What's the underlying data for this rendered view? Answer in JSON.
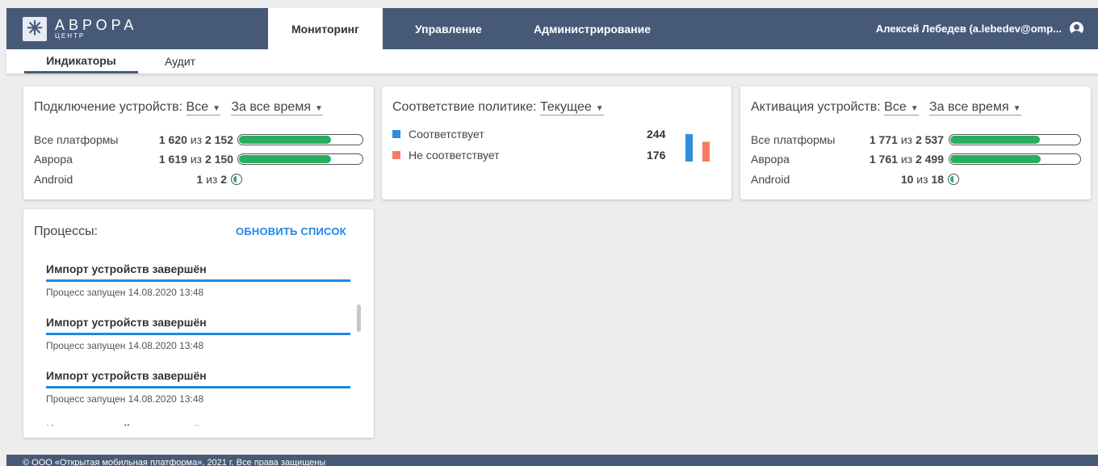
{
  "brand": {
    "name": "АВРОРА",
    "sub": "ЦЕНТР"
  },
  "nav": {
    "tabs": [
      {
        "label": "Мониторинг",
        "active": true
      },
      {
        "label": "Управление",
        "active": false
      },
      {
        "label": "Администрирование",
        "active": false
      }
    ],
    "user": "Алексей Лебедев (a.lebedev@omp..."
  },
  "subnav": {
    "tabs": [
      {
        "label": "Индикаторы",
        "active": true
      },
      {
        "label": "Аудит",
        "active": false
      }
    ]
  },
  "connection": {
    "title": "Подключение устройств:",
    "filter1": "Все",
    "filter2": "За все время",
    "rows": [
      {
        "label": "Все платформы",
        "value": "1 620",
        "sep": "из",
        "total": "2 152",
        "fraction": 0.753
      },
      {
        "label": "Аврора",
        "value": "1 619",
        "sep": "из",
        "total": "2 150",
        "fraction": 0.753
      },
      {
        "label": "Android",
        "value": "1",
        "sep": "из",
        "total": "2",
        "fraction": 0.5
      }
    ]
  },
  "compliance": {
    "title": "Соответствие политике:",
    "filter": "Текущее",
    "items": [
      {
        "label": "Соответствует",
        "value": "244",
        "color": "#2d8fdd"
      },
      {
        "label": "Не соответствует",
        "value": "176",
        "color": "#f47c63"
      }
    ]
  },
  "activation": {
    "title": "Активация устройств:",
    "filter1": "Все",
    "filter2": "За все время",
    "rows": [
      {
        "label": "Все платформы",
        "value": "1 771",
        "sep": "из",
        "total": "2 537",
        "fraction": 0.698
      },
      {
        "label": "Аврора",
        "value": "1 761",
        "sep": "из",
        "total": "2 499",
        "fraction": 0.705
      },
      {
        "label": "Android",
        "value": "10",
        "sep": "из",
        "total": "18",
        "fraction": 0.556
      }
    ]
  },
  "processes": {
    "title": "Процессы:",
    "refresh": "ОБНОВИТЬ СПИСОК",
    "items": [
      {
        "title": "Импорт устройств завершён",
        "sub": "Процесс запущен 14.08.2020 13:48"
      },
      {
        "title": "Импорт устройств завершён",
        "sub": "Процесс запущен 14.08.2020 13:48"
      },
      {
        "title": "Импорт устройств завершён",
        "sub": "Процесс запущен 14.08.2020 13:48"
      },
      {
        "title": "Импорт устройств завершён",
        "sub": ""
      }
    ]
  },
  "footer": "© ООО «Открытая мобильная платформа», 2021 г. Все права защищены"
}
